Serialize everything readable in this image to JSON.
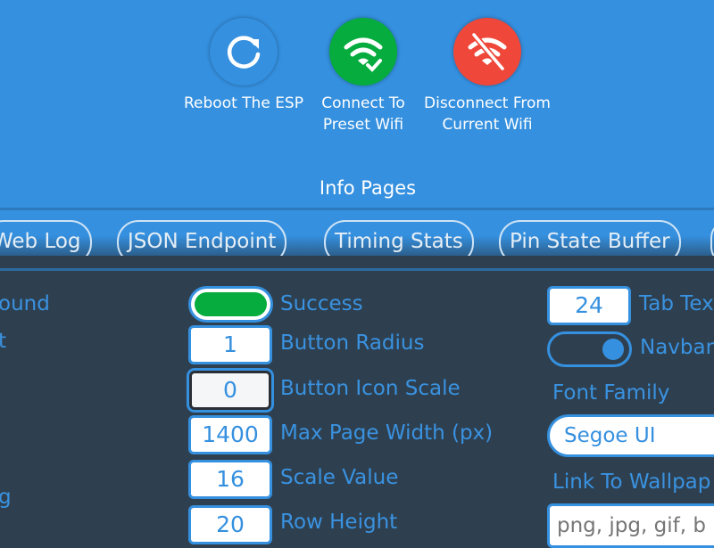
{
  "actions": [
    {
      "label": "Reboot The ESP",
      "icon": "refresh-icon",
      "color": "#3590df"
    },
    {
      "label": "Connect To Preset Wifi",
      "icon": "wifi-check-icon",
      "color": "#06ac3e"
    },
    {
      "label": "Disconnect From Current Wifi",
      "icon": "wifi-off-icon",
      "color": "#ef473a"
    }
  ],
  "info_title": "Info Pages",
  "tabs": [
    "Web Log",
    "JSON Endpoint",
    "Timing Stats",
    "Pin State Buffer"
  ],
  "left_labels": [
    "ound",
    "t",
    "g"
  ],
  "settings_mid": [
    {
      "label": "Success",
      "type": "color",
      "color": "#06ac3e"
    },
    {
      "label": "Button Radius",
      "value": "1"
    },
    {
      "label": "Button Icon Scale",
      "value": "0"
    },
    {
      "label": "Max Page Width (px)",
      "value": "1400"
    },
    {
      "label": "Scale Value",
      "value": "16"
    },
    {
      "label": "Row Height",
      "value": "20"
    }
  ],
  "settings_right": {
    "tab_text": {
      "label": "Tab Tex",
      "value": "24"
    },
    "navbar": {
      "label": "Navbar",
      "on": true
    },
    "font_family": {
      "label": "Font Family",
      "value": "Segoe UI"
    },
    "wallpaper": {
      "label": "Link To Wallpap",
      "placeholder": "png, jpg, gif, b"
    }
  }
}
